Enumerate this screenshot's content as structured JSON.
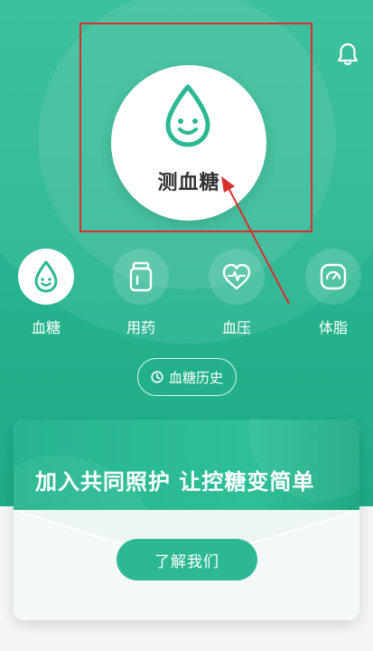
{
  "main": {
    "measure_label": "测血糖"
  },
  "features": [
    {
      "label": "血糖",
      "icon": "drop-face-icon",
      "active": true
    },
    {
      "label": "用药",
      "icon": "medicine-bottle-icon",
      "active": false
    },
    {
      "label": "血压",
      "icon": "heart-pulse-icon",
      "active": false
    },
    {
      "label": "体脂",
      "icon": "scale-gauge-icon",
      "active": false
    }
  ],
  "history_button": {
    "label": "血糖历史",
    "icon": "clock-icon"
  },
  "banner": {
    "title": "加入共同照护 让控糖变简单",
    "cta_label": "了解我们"
  },
  "colors": {
    "primary": "#2cb893",
    "annotation": "#d9302f"
  }
}
